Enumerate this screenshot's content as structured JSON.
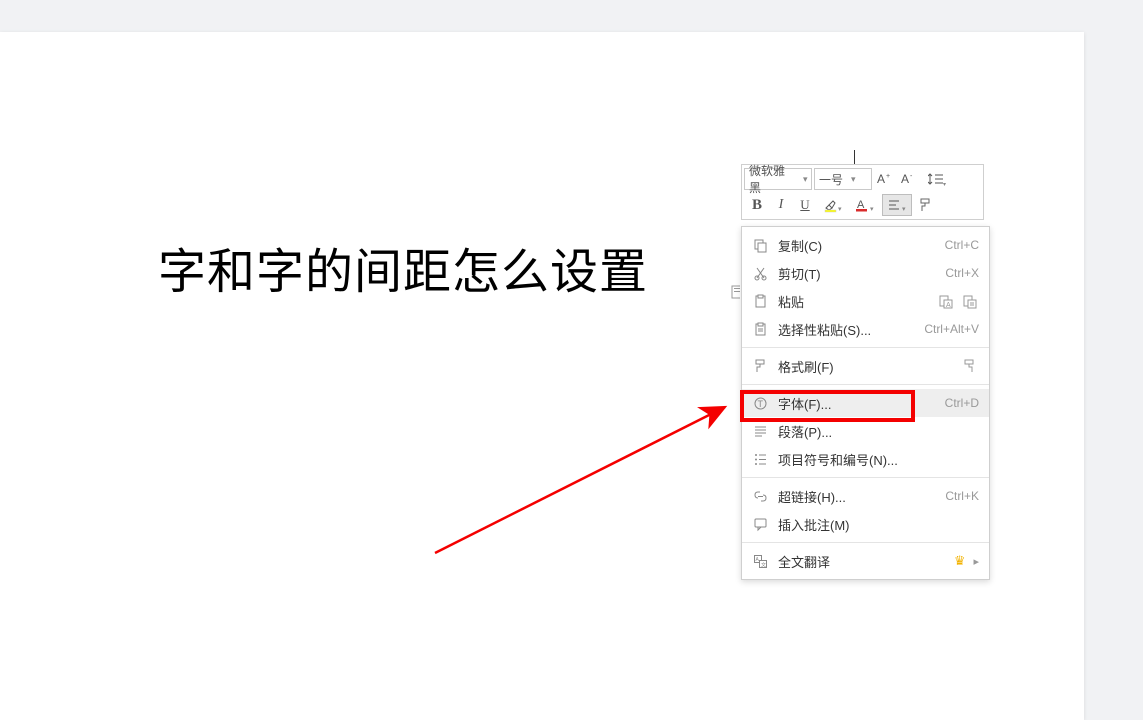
{
  "document": {
    "text": "字和字的间距怎么设置"
  },
  "mini_toolbar": {
    "font_name": "微软雅黑",
    "font_size": "一号"
  },
  "context_menu": {
    "copy": {
      "label": "复制(C)",
      "shortcut": "Ctrl+C"
    },
    "cut": {
      "label": "剪切(T)",
      "shortcut": "Ctrl+X"
    },
    "paste": {
      "label": "粘贴"
    },
    "paste_special": {
      "label": "选择性粘贴(S)...",
      "shortcut": "Ctrl+Alt+V"
    },
    "format_painter": {
      "label": "格式刷(F)"
    },
    "font": {
      "label": "字体(F)...",
      "shortcut": "Ctrl+D"
    },
    "paragraph": {
      "label": "段落(P)..."
    },
    "bullets": {
      "label": "项目符号和编号(N)..."
    },
    "hyperlink": {
      "label": "超链接(H)...",
      "shortcut": "Ctrl+K"
    },
    "comment": {
      "label": "插入批注(M)"
    },
    "translate": {
      "label": "全文翻译"
    }
  }
}
